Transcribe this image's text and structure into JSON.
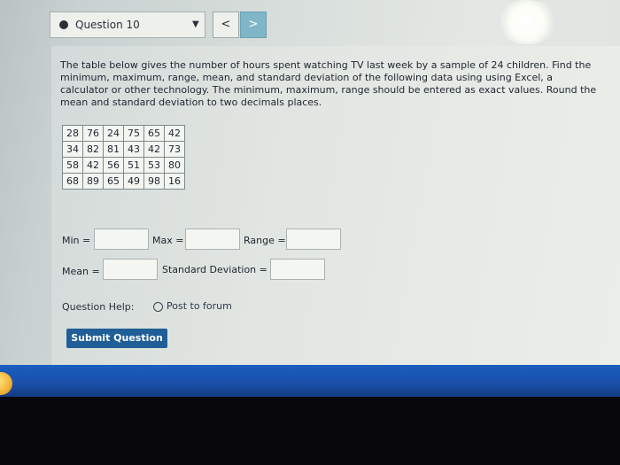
{
  "header": {
    "question_label": "Question 10",
    "prev_label": "<",
    "next_label": ">"
  },
  "prompt": "The table below gives the number of hours spent watching TV last week by a sample of 24 children. Find the minimum, maximum, range, mean, and standard deviation of the following data using using Excel, a calculator or other technology. The minimum, maximum, range should be entered as exact values. Round the mean and standard deviation to two decimals places.",
  "table": {
    "rows": [
      [
        "28",
        "76",
        "24",
        "75",
        "65",
        "42"
      ],
      [
        "34",
        "82",
        "81",
        "43",
        "42",
        "73"
      ],
      [
        "58",
        "42",
        "56",
        "51",
        "53",
        "80"
      ],
      [
        "68",
        "89",
        "65",
        "49",
        "98",
        "16"
      ]
    ]
  },
  "fields": {
    "min_label": "Min =",
    "max_label": "Max =",
    "range_label": "Range =",
    "mean_label": "Mean =",
    "sd_label": "Standard Deviation ="
  },
  "help": {
    "label": "Question Help:",
    "forum_label": "Post to forum"
  },
  "submit_label": "Submit Question",
  "colors": {
    "submit": "#1f5e97",
    "next_button": "#7fb6c8",
    "taskbar": "#1a4fa8"
  }
}
